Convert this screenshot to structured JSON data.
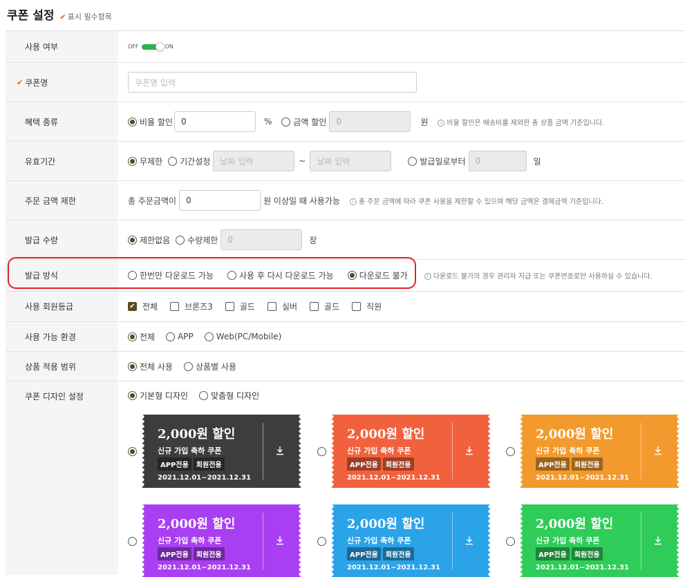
{
  "header": {
    "title": "쿠폰 설정",
    "required_note": "표시 필수항목"
  },
  "colors": {
    "accent": "#5a4a1e",
    "check": "#e8601c",
    "toggle": "#2db24a",
    "highlight": "#e31e24"
  },
  "rows": {
    "usage": {
      "label": "사용 여부",
      "off": "OFF",
      "on": "ON",
      "enabled": true
    },
    "name": {
      "label": "쿠폰명",
      "placeholder": "쿠폰명 입력"
    },
    "benefit": {
      "label": "혜택 종류",
      "opt_rate": "비율 할인",
      "rate_value": "0",
      "rate_unit": "%",
      "opt_amount": "금액 할인",
      "amount_value": "0",
      "amount_unit": "원",
      "hint": "비율 할인은 배송비를 제외한 총 상품 금액 기준입니다."
    },
    "period": {
      "label": "유효기간",
      "opt_unlimited": "무제한",
      "opt_range": "기간설정",
      "date_placeholder": "날짜 입력",
      "tilde": "~",
      "opt_from_issue": "발급일로부터",
      "days_value": "0",
      "days_unit": "일"
    },
    "order_limit": {
      "label": "주문 금액 제한",
      "prefix": "총 주문금액이",
      "value": "0",
      "suffix": "원 이상일 때 사용가능",
      "hint": "총 주문 금액에 따라 쿠폰 사용을 제한할 수 있으며 해당 금액은 결제금액 기준입니다."
    },
    "issue_qty": {
      "label": "발급 수량",
      "opt_unlimited": "제한없음",
      "opt_limited": "수량제한",
      "qty_value": "0",
      "qty_unit": "장"
    },
    "issue_method": {
      "label": "발급 방식",
      "opt_once": "한번만 다운로드 가능",
      "opt_again": "사용 후 다시 다운로드 가능",
      "opt_none": "다운로드 불가",
      "hint": "다운로드 불가의 경우 관리자 지급 또는 쿠폰번호로만 사용하실 수 있습니다."
    },
    "grade": {
      "label": "사용 회원등급",
      "options": [
        "전체",
        "브론즈3",
        "골드",
        "실버",
        "골드",
        "직원"
      ]
    },
    "env": {
      "label": "사용 가능 환경",
      "opt_all": "전체",
      "opt_app": "APP",
      "opt_web": "Web(PC/Mobile)"
    },
    "scope": {
      "label": "상품 적용 범위",
      "opt_all": "전체 사용",
      "opt_product": "상품별 사용"
    },
    "design": {
      "label": "쿠폰 디자인 설정",
      "opt_basic": "기본형 디자인",
      "opt_custom": "맞춤형 디자인"
    }
  },
  "coupon": {
    "title": "2,000원 할인",
    "subtitle": "신규 가입 축하 쿠폰",
    "tag1": "APP전용",
    "tag2": "회원전용",
    "date": "2021.12.01~2021.12.31"
  },
  "coupon_colors": [
    "#3d3d3d",
    "#f2613d",
    "#f29a2e",
    "#a93ff2",
    "#2aa3e8",
    "#2fcc5a"
  ]
}
